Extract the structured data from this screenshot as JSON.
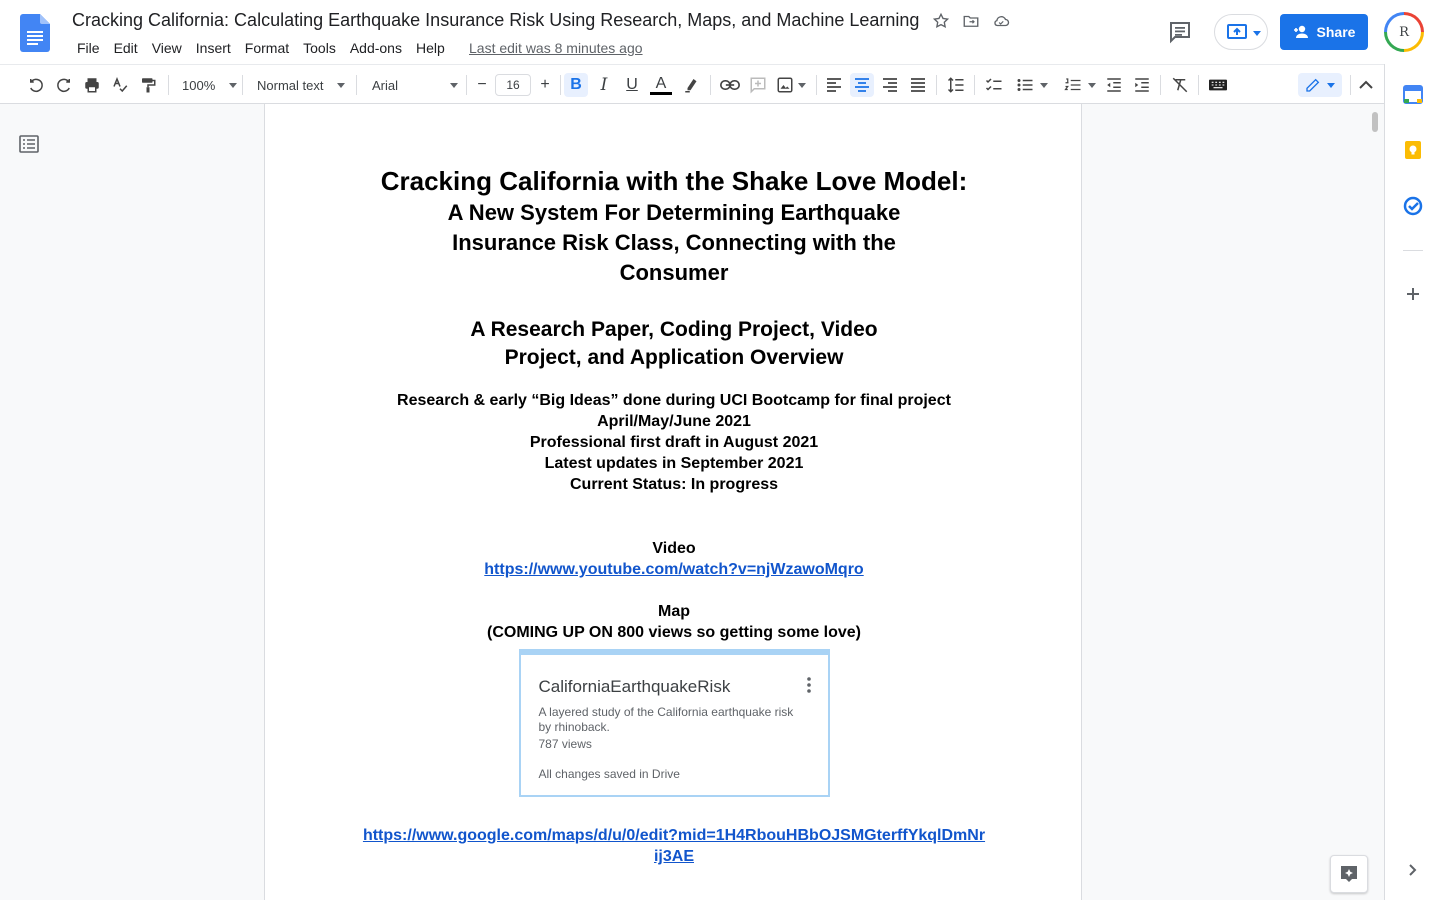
{
  "header": {
    "doc_title": "Cracking California: Calculating Earthquake Insurance Risk Using Research, Maps, and Machine Learning",
    "menu": [
      "File",
      "Edit",
      "View",
      "Insert",
      "Format",
      "Tools",
      "Add-ons",
      "Help"
    ],
    "last_edit": "Last edit was 8 minutes ago",
    "share_label": "Share",
    "avatar_initial": "R"
  },
  "toolbar": {
    "zoom": "100%",
    "style": "Normal text",
    "font": "Arial",
    "font_size": "16",
    "bold_label": "B",
    "italic_label": "I",
    "underline_label": "U",
    "text_color_label": "A"
  },
  "document": {
    "title_line1": "Cracking California with the Shake Love Model:",
    "title_line2": "A New System For Determining Earthquake Insurance Risk Class, Connecting with the Consumer",
    "subtitle": "A Research Paper, Coding Project, Video Project, and Application Overview",
    "info_lines": [
      "Research & early “Big Ideas” done during UCI Bootcamp for final project",
      "April/May/June 2021",
      "Professional first draft in August 2021",
      "Latest updates in September 2021",
      "Current Status: In progress"
    ],
    "video_heading": "Video",
    "video_link": "https://www.youtube.com/watch?v=njWzawoMqro",
    "map_heading": "Map",
    "map_note": "(COMING UP ON 800 views so getting some love)",
    "map_card": {
      "title": "CaliforniaEarthquakeRisk",
      "description": "A layered study of the California earthquake risk by rhinoback.",
      "views": "787 views",
      "saved": "All changes saved in Drive"
    },
    "map_link": "https://www.google.com/maps/d/u/0/edit?mid=1H4RbouHBbOJSMGterffYkqlDmNrij3AE"
  },
  "colors": {
    "accent": "#1a73e8",
    "link": "#1155cc",
    "page_bg": "#f8f9fa"
  }
}
